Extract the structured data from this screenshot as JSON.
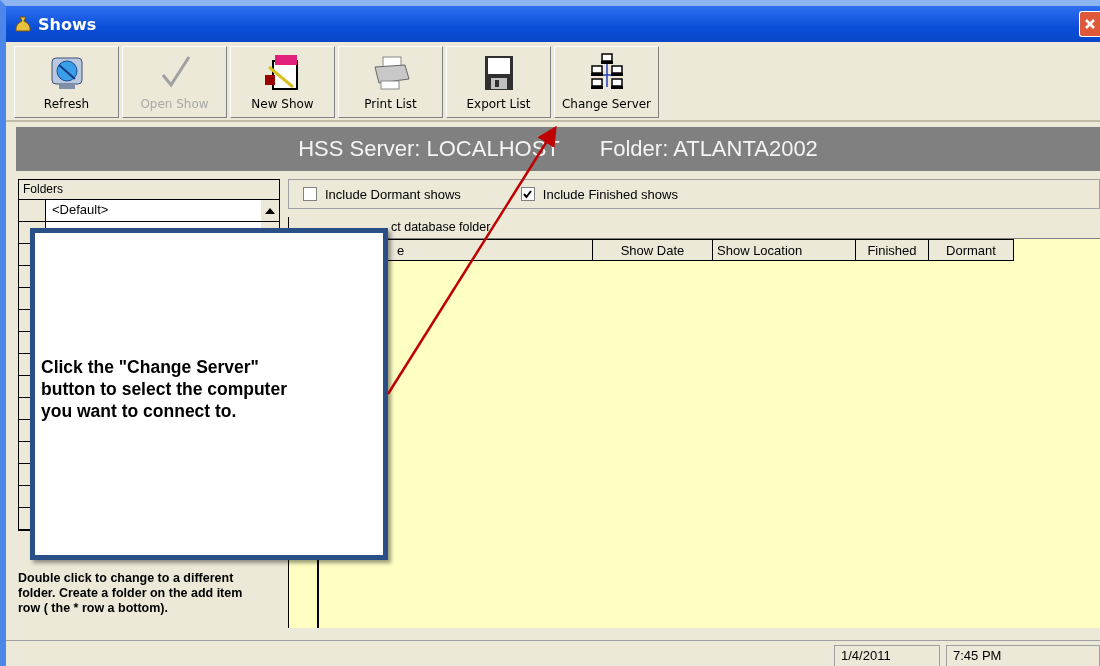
{
  "window": {
    "title": "Shows"
  },
  "toolbar": [
    {
      "kind": "refresh",
      "label": "Refresh",
      "disabled": false
    },
    {
      "kind": "check",
      "label": "Open Show",
      "disabled": true
    },
    {
      "kind": "notepad",
      "label": "New Show",
      "disabled": false
    },
    {
      "kind": "printer",
      "label": "Print List",
      "disabled": false
    },
    {
      "kind": "floppy",
      "label": "Export List",
      "disabled": false
    },
    {
      "kind": "network",
      "label": "Change Server",
      "disabled": false
    }
  ],
  "banner": {
    "server": "HSS Server: LOCALHOST",
    "folder": "Folder: ATLANTA2002"
  },
  "folders": {
    "header": "Folders",
    "rows": [
      "<Default>"
    ],
    "help": "Double click to change to a different folder.  Create a folder on the add item row ( the * row a bottom)."
  },
  "filters": [
    {
      "label": "Include Dormant shows",
      "checked": false
    },
    {
      "label": "Include Finished shows",
      "checked": true
    }
  ],
  "grid": {
    "caption": "ct database folder",
    "columns": [
      "e",
      "Show Date",
      "Show Location",
      "Finished",
      "Dormant"
    ]
  },
  "callout": {
    "text": "Click the \"Change Server\" button to select the computer you want to connect to."
  },
  "status_bar": {
    "date": "1/4/2011",
    "time": "7:45 PM"
  }
}
